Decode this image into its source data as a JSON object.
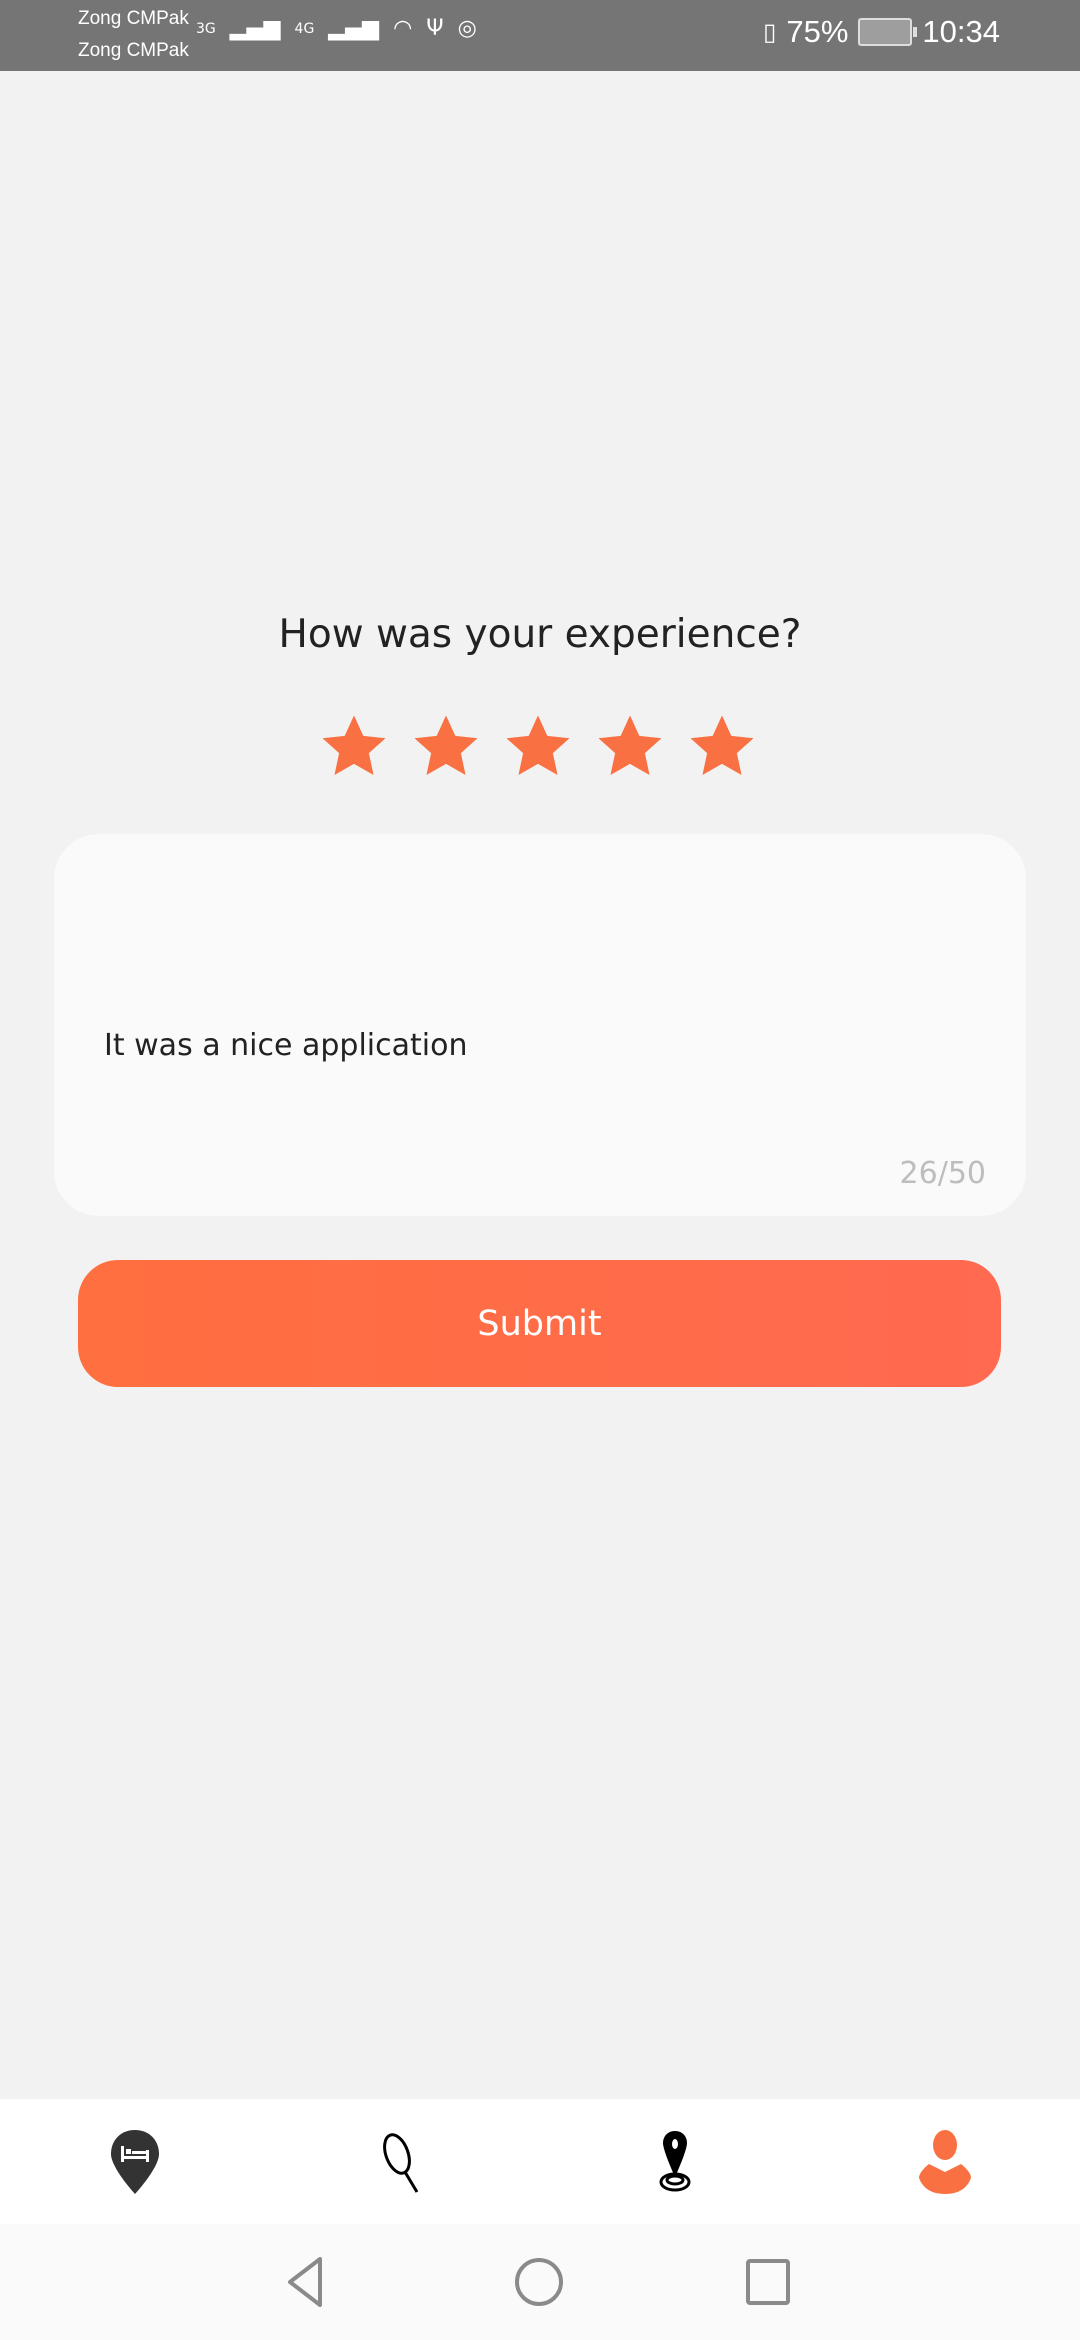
{
  "status_bar": {
    "carrier_1": "Zong CMPak",
    "carrier_2": "Zong CMPak",
    "net_1": "3G",
    "net_2": "4G",
    "battery": "75%",
    "time": "10:34"
  },
  "feedback": {
    "title": "How was your experience?",
    "rating": 5,
    "rating_max": 5,
    "comment_value": "It was a nice application",
    "char_counter": "26/50",
    "submit_label": "Submit"
  },
  "bottom_nav": {
    "items": [
      "hotel-pin-icon",
      "search-icon",
      "location-icon",
      "profile-icon"
    ],
    "active": "profile-icon"
  },
  "colors": {
    "accent": "#f97142",
    "background": "#f2f2f2",
    "status_bar": "#757575"
  }
}
